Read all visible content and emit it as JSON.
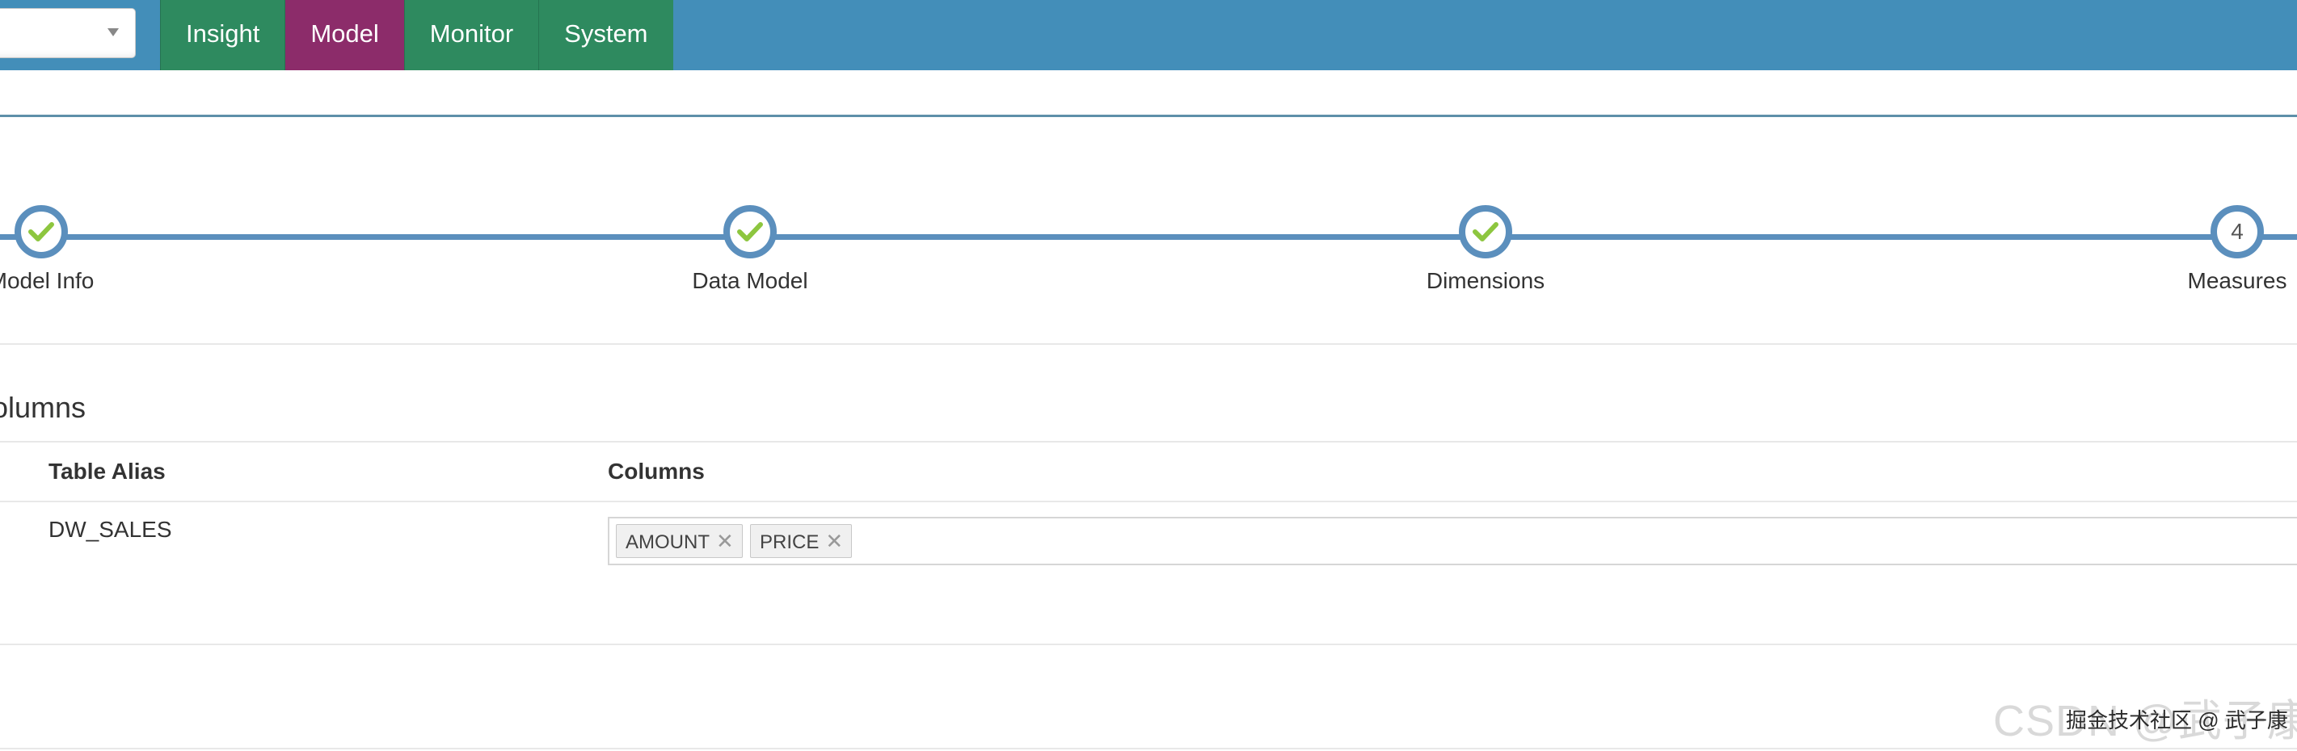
{
  "nav": {
    "tabs": [
      {
        "label": "Insight",
        "active": false
      },
      {
        "label": "Model",
        "active": true
      },
      {
        "label": "Monitor",
        "active": false
      },
      {
        "label": "System",
        "active": false
      }
    ]
  },
  "wizard": {
    "steps": [
      {
        "label": "Model Info",
        "status": "done"
      },
      {
        "label": "Data Model",
        "status": "done"
      },
      {
        "label": "Dimensions",
        "status": "done"
      },
      {
        "label": "Measures",
        "status": "current",
        "number": "4"
      }
    ]
  },
  "section": {
    "title": "olumns",
    "table": {
      "headers": [
        "Table Alias",
        "Columns"
      ],
      "rows": [
        {
          "alias": "DW_SALES",
          "columns": [
            "AMOUNT",
            "PRICE"
          ]
        }
      ]
    }
  },
  "watermarks": {
    "csdn": "CSDN @武子康",
    "juejin": "掘金技术社区 @ 武子康"
  },
  "colors": {
    "navbar": "#438eb9",
    "nav_tab": "#2e8a5f",
    "nav_tab_active": "#8c2c6a",
    "wizard_line": "#5b8fbd",
    "check": "#8dc63f"
  }
}
